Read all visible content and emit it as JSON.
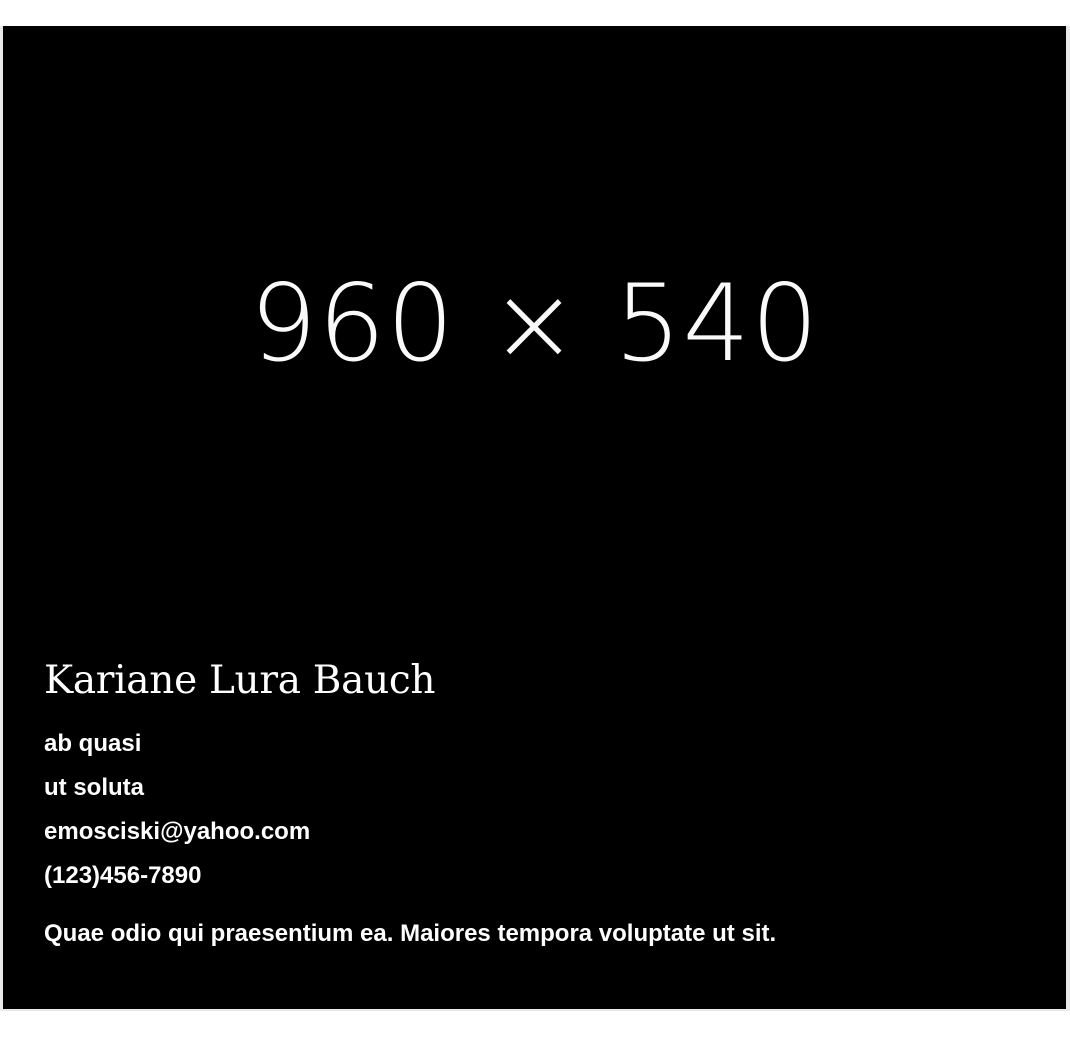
{
  "card": {
    "image_placeholder_text": "960 × 540",
    "name": "Kariane Lura Bauch",
    "details": [
      "ab quasi",
      "ut soluta",
      "emosciski@yahoo.com",
      "(123)456-7890"
    ],
    "bio": "Quae odio qui praesentium ea. Maiores tempora voluptate ut sit."
  },
  "colors": {
    "card_background": "#000000",
    "text": "#ffffff",
    "page_background": "#ffffff"
  }
}
